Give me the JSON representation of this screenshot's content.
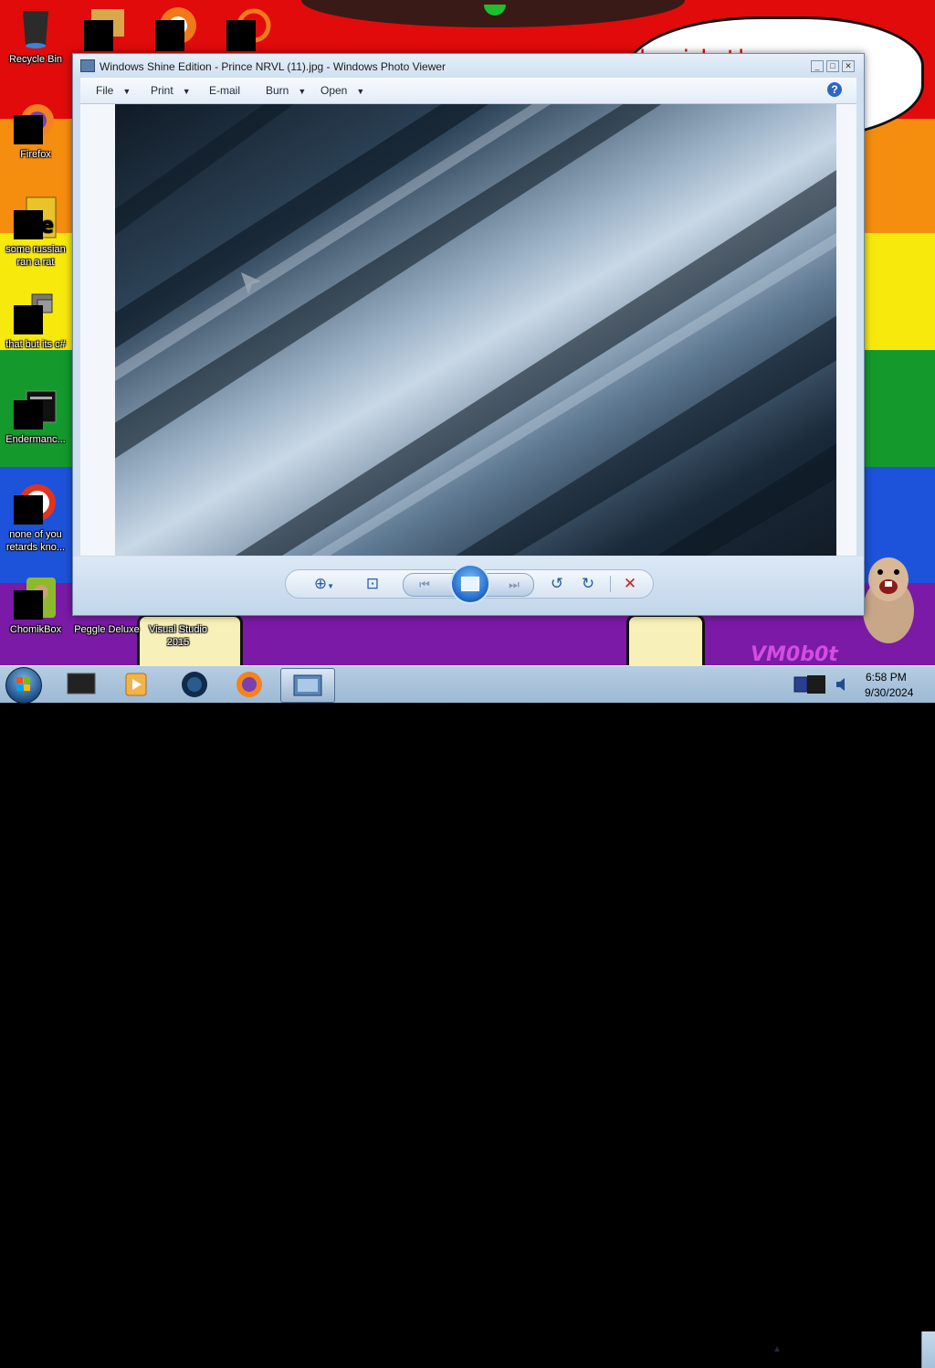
{
  "desktop": {
    "icons": [
      {
        "label": "Recycle Bin"
      },
      {
        "label": "Firefox"
      },
      {
        "label": "some russian ran a rat"
      },
      {
        "label": "that but its c#"
      },
      {
        "label": "Endermanc..."
      },
      {
        "label": "none of you retards kno..."
      },
      {
        "label": "ChomikBox"
      },
      {
        "label": "Peggle Deluxe"
      },
      {
        "label": "Visual Studio 2015"
      }
    ],
    "bubble_text": "l       e     i    h        th",
    "watermark": "VM0b0t"
  },
  "photo_viewer": {
    "title": "Windows Shine Edition - Prince NRVL (11).jpg - Windows Photo Viewer",
    "menu": [
      {
        "label": "File"
      },
      {
        "label": "Print"
      },
      {
        "label": "E-mail"
      },
      {
        "label": "Burn"
      },
      {
        "label": "Open"
      }
    ],
    "window_buttons": {
      "minimize": "_",
      "maximize": "□",
      "close": "✕"
    },
    "help": "?"
  },
  "taskbar": {
    "clock_time": "6:58 PM",
    "clock_date": "9/30/2024",
    "tray_arrow": "▲"
  }
}
